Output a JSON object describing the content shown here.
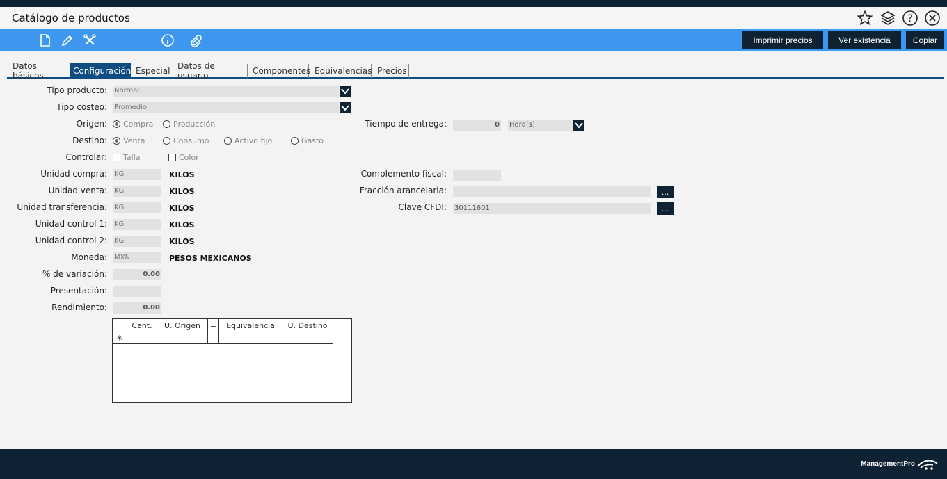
{
  "window": {
    "title": "Catálogo de productos"
  },
  "toolbar": {
    "buttons": {
      "print_prices": "Imprimir precios",
      "view_stock": "Ver existencia",
      "copy": "Copiar"
    }
  },
  "tabs": [
    "Datos básicos",
    "Configuración",
    "Especial",
    "Datos de usuario",
    "Componentes",
    "Equivalencias",
    "Precios"
  ],
  "form": {
    "tipo_producto": {
      "label": "Tipo producto:",
      "value": "Normal"
    },
    "tipo_costeo": {
      "label": "Tipo costeo:",
      "value": "Promedio"
    },
    "origen": {
      "label": "Origen:",
      "options": [
        "Compra",
        "Producción"
      ],
      "selected": "Compra"
    },
    "destino": {
      "label": "Destino:",
      "options": [
        "Venta",
        "Consumo",
        "Activo fijo",
        "Gasto"
      ],
      "selected": "Venta"
    },
    "controlar": {
      "label": "Controlar:",
      "options": [
        "Talla",
        "Color"
      ]
    },
    "unidad_compra": {
      "label": "Unidad compra:",
      "code": "KG",
      "name": "KILOS"
    },
    "unidad_venta": {
      "label": "Unidad venta:",
      "code": "KG",
      "name": "KILOS"
    },
    "unidad_transferencia": {
      "label": "Unidad transferencia:",
      "code": "KG",
      "name": "KILOS"
    },
    "unidad_control_1": {
      "label": "Unidad control 1:",
      "code": "KG",
      "name": "KILOS"
    },
    "unidad_control_2": {
      "label": "Unidad control 2:",
      "code": "KG",
      "name": "KILOS"
    },
    "moneda": {
      "label": "Moneda:",
      "code": "MXN",
      "name": "PESOS MEXICANOS"
    },
    "variacion": {
      "label": "% de variación:",
      "value": "0.00"
    },
    "presentacion": {
      "label": "Presentación:",
      "value": ""
    },
    "rendimiento": {
      "label": "Rendimiento:",
      "value": "0.00"
    },
    "tiempo_entrega": {
      "label": "Tiempo de entrega:",
      "value": "0",
      "unit": "Hora(s)"
    },
    "complemento_fiscal": {
      "label": "Complemento fiscal:",
      "value": ""
    },
    "fraccion_arancelaria": {
      "label": "Fracción arancelaria:",
      "value": "",
      "button": "..."
    },
    "clave_cfdi": {
      "label": "Clave CFDI:",
      "value": "30111601",
      "button": "..."
    }
  },
  "grid": {
    "headers": [
      "",
      "Cant.",
      "U. Origen",
      "=",
      "Equivalencia",
      "U. Destino"
    ],
    "new_row_marker": "✳"
  },
  "footer": {
    "brand": "ManagementPro"
  },
  "colors": {
    "toolbar": "#3e97ee",
    "dark": "#0f2233",
    "tab_active": "#0f4c81"
  }
}
